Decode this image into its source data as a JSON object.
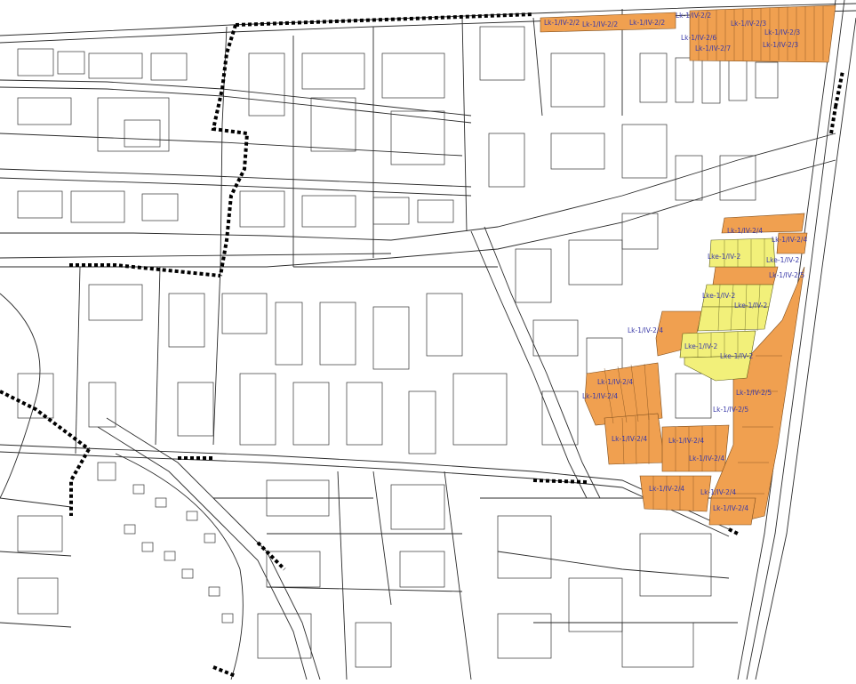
{
  "colors": {
    "background": "#ffffff",
    "line": "#2a2a2a",
    "zone_orange": "#f0a050",
    "zone_yellow": "#f2f07a",
    "boundary": "#000000",
    "label": "#3a3aa8"
  },
  "zone_labels": [
    "Lk-1/IV-2/2",
    "Lk-1/IV-2/2",
    "Lk-1/IV-2/2",
    "Lk-1/IV-2/2",
    "Lk-1/IV-2/3",
    "Lk-1/IV-2/3",
    "Lk-1/IV-2/6",
    "Lk-1/IV-2/3",
    "Lk-1/IV-2/7",
    "Lk-1/IV-2/4",
    "Lk-1/IV-2/4",
    "Lke-1/IV-2",
    "Lke-1/IV-2",
    "Lk-1/IV-2/5",
    "Lke-1/IV-2",
    "Lke-1/IV-2",
    "Lk-1/IV-2/4",
    "Lke-1/IV-2",
    "Lke-1/IV-2",
    "Lk-1/IV-2/4",
    "Lk-1/IV-2/4",
    "Lk-1/IV-2/5",
    "Lk-1/IV-2/5",
    "Lk-1/IV-2/4",
    "Lk-1/IV-2/4",
    "Lk-1/IV-2/4",
    "Lk-1/IV-2/4",
    "Lk-1/IV-2/4",
    "Lk-1/IV-2/4"
  ]
}
